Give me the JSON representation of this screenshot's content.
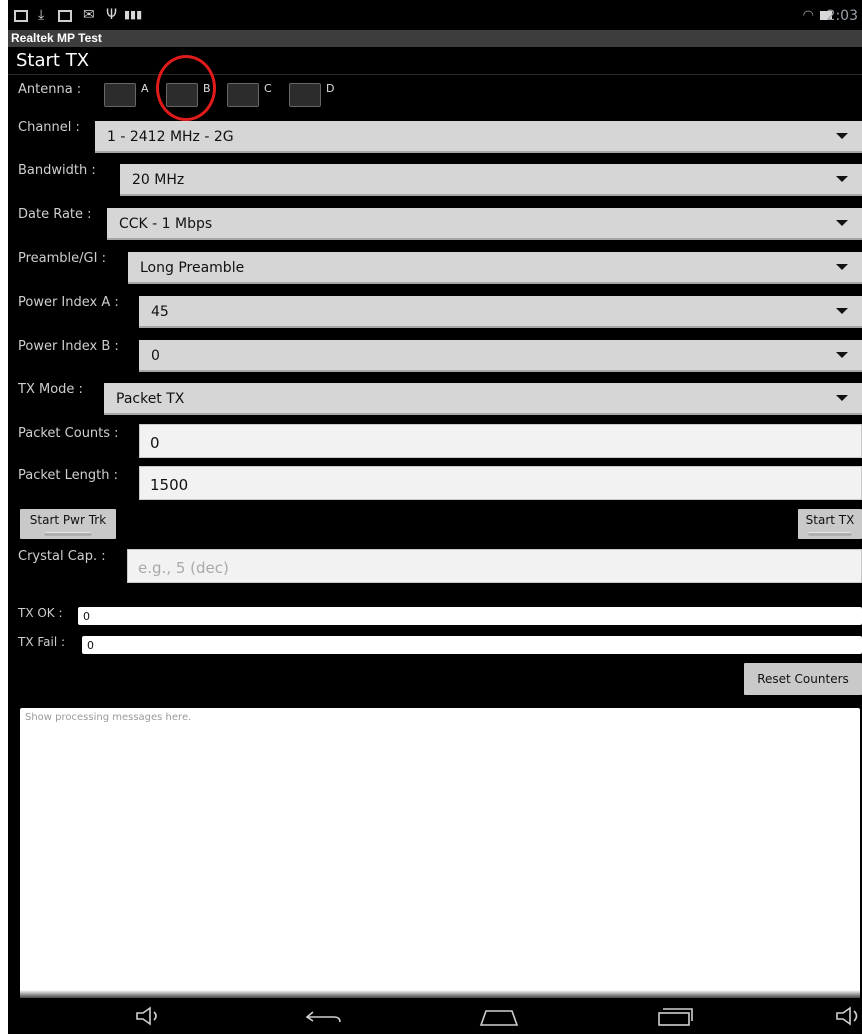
{
  "app": {
    "title": "Realtek MP Test",
    "section": "Start TX",
    "time": "2:03"
  },
  "antenna": {
    "label": "Antenna :",
    "options": [
      "A",
      "B",
      "C",
      "D"
    ]
  },
  "channel": {
    "label": "Channel :",
    "value": "1 - 2412 MHz - 2G"
  },
  "bandwidth": {
    "label": "Bandwidth :",
    "value": "20 MHz"
  },
  "data_rate": {
    "label": "Date Rate :",
    "value": "CCK - 1 Mbps"
  },
  "preamble": {
    "label": "Preamble/GI :",
    "value": "Long Preamble"
  },
  "power_a": {
    "label": "Power Index A :",
    "value": "45"
  },
  "power_b": {
    "label": "Power Index B :",
    "value": "0"
  },
  "tx_mode": {
    "label": "TX Mode :",
    "value": "Packet TX"
  },
  "packet_counts": {
    "label": "Packet Counts :",
    "value": "0"
  },
  "packet_length": {
    "label": "Packet Length :",
    "value": "1500"
  },
  "buttons": {
    "start_pwr_trk": "Start Pwr Trk",
    "start_tx": "Start TX",
    "reset_counters": "Reset Counters"
  },
  "crystal": {
    "label": "Crystal Cap. :",
    "placeholder": "e.g., 5 (dec)"
  },
  "tx_ok": {
    "label": "TX OK :",
    "value": "0"
  },
  "tx_fail": {
    "label": "TX Fail :",
    "value": "0"
  },
  "log": {
    "placeholder": "Show processing messages here."
  },
  "colors": {
    "background": "#000000",
    "highlight_ring": "#e01b1b",
    "dropdown": "#d6d6d6"
  }
}
